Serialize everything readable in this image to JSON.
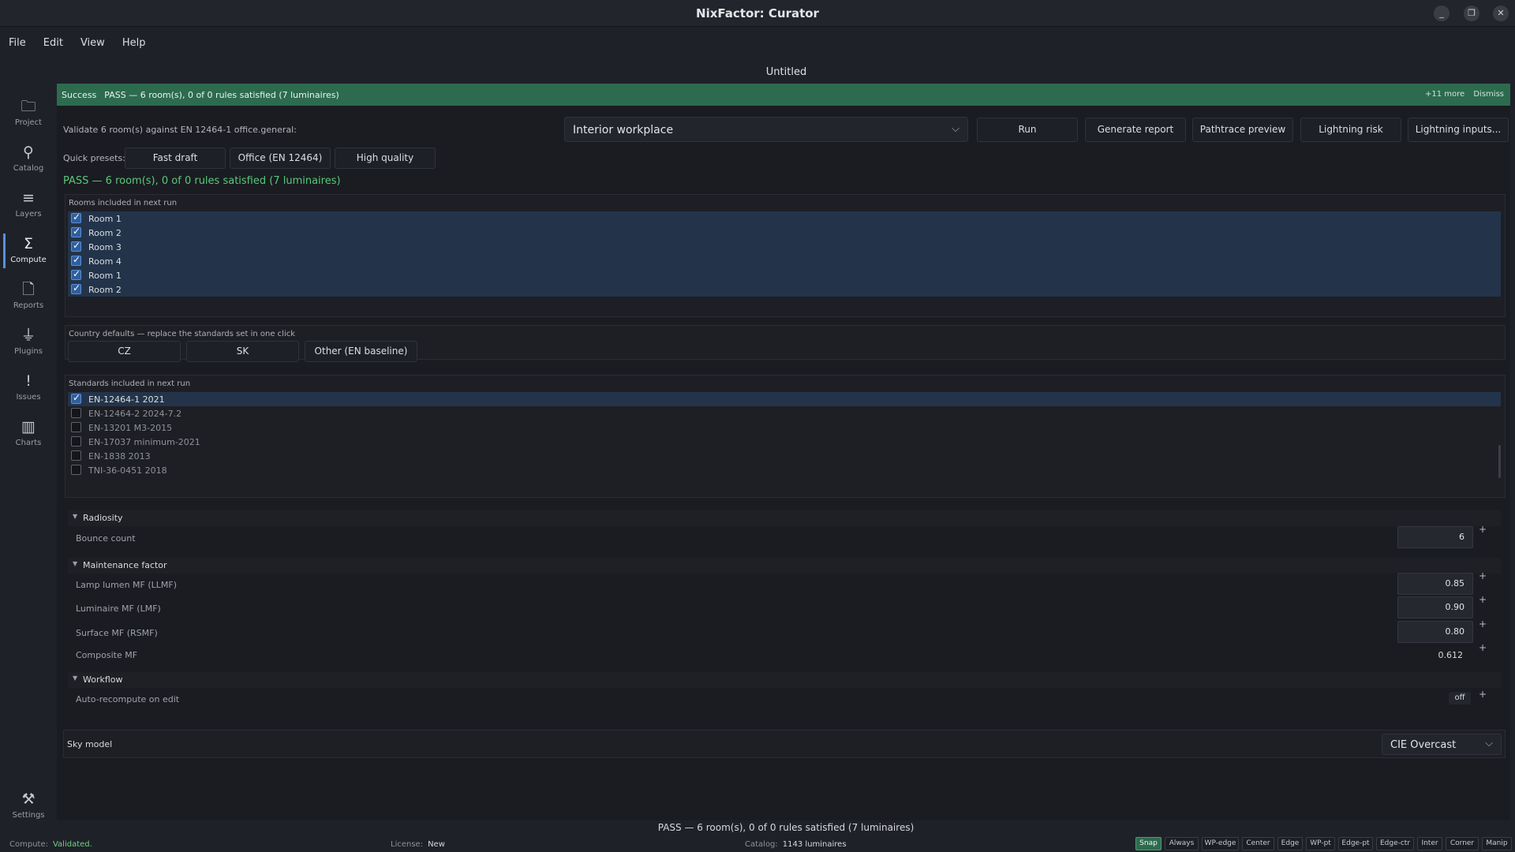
{
  "window": {
    "title": "NixFactor: Curator"
  },
  "menu": {
    "items": [
      "File",
      "Edit",
      "View",
      "Help"
    ]
  },
  "document": {
    "title": "Untitled"
  },
  "sidebar": {
    "items": [
      {
        "label": "Project",
        "icon": "folder-icon"
      },
      {
        "label": "Catalog",
        "icon": "bulb-icon"
      },
      {
        "label": "Layers",
        "icon": "layers-icon"
      },
      {
        "label": "Compute",
        "icon": "sigma-icon",
        "active": true
      },
      {
        "label": "Reports",
        "icon": "document-icon"
      },
      {
        "label": "Plugins",
        "icon": "plug-icon"
      },
      {
        "label": "Issues",
        "icon": "exclamation-icon"
      },
      {
        "label": "Charts",
        "icon": "bar-chart-icon"
      }
    ],
    "settings": {
      "label": "Settings",
      "icon": "tools-icon"
    }
  },
  "banner": {
    "label": "Success",
    "message": "PASS — 6 room(s), 0 of 0 rules satisfied (7 luminaires)",
    "more": "+11 more",
    "dismiss": "Dismiss",
    "color": "#2d6b4e"
  },
  "validate": {
    "label": "Validate 6 room(s) against EN 12464-1 office.general:",
    "profile": "Interior workplace",
    "buttons": {
      "run": "Run",
      "report": "Generate report",
      "pathtrace": "Pathtrace preview",
      "lightning": "Lightning risk",
      "lightning_inputs": "Lightning inputs..."
    }
  },
  "presets": {
    "label": "Quick presets:",
    "items": [
      "Fast draft",
      "Office (EN 12464)",
      "High quality"
    ]
  },
  "result": {
    "text": "PASS — 6 room(s), 0 of 0 rules satisfied (7 luminaires)",
    "color": "#5ac878"
  },
  "rooms": {
    "title": "Rooms included in next run",
    "items": [
      {
        "name": "Room 1",
        "checked": true
      },
      {
        "name": "Room 2",
        "checked": true
      },
      {
        "name": "Room 3",
        "checked": true
      },
      {
        "name": "Room 4",
        "checked": true
      },
      {
        "name": "Room 1",
        "checked": true
      },
      {
        "name": "Room 2",
        "checked": true
      }
    ]
  },
  "country": {
    "title": "Country defaults — replace the standards set in one click",
    "buttons": [
      "CZ",
      "SK",
      "Other (EN baseline)"
    ]
  },
  "standards": {
    "title": "Standards included in next run",
    "items": [
      {
        "name": "EN-12464-1 2021",
        "checked": true
      },
      {
        "name": "EN-12464-2 2024-7.2",
        "checked": false
      },
      {
        "name": "EN-13201 M3-2015",
        "checked": false
      },
      {
        "name": "EN-17037 minimum-2021",
        "checked": false
      },
      {
        "name": "EN-1838 2013",
        "checked": false
      },
      {
        "name": "TNI-36-0451 2018",
        "checked": false
      }
    ]
  },
  "radiosity": {
    "title": "Radiosity",
    "bounce_label": "Bounce count",
    "bounce_value": "6"
  },
  "maintenance": {
    "title": "Maintenance factor",
    "llmf_label": "Lamp lumen MF (LLMF)",
    "llmf": "0.85",
    "lmf_label": "Luminaire MF (LMF)",
    "lmf": "0.90",
    "rsmf_label": "Surface MF (RSMF)",
    "rsmf": "0.80",
    "composite_label": "Composite MF",
    "composite": "0.612"
  },
  "workflow": {
    "title": "Workflow",
    "auto_label": "Auto-recompute on edit",
    "auto_value": "off"
  },
  "sky": {
    "label": "Sky model",
    "value": "CIE Overcast"
  },
  "bottom_message": "PASS — 6 room(s), 0 of 0 rules satisfied (7 luminaires)",
  "status": {
    "compute_label": "Compute:",
    "compute_value": "Validated.",
    "license_label": "License:",
    "license_value": "New",
    "catalog_label": "Catalog:",
    "catalog_value": "1143 luminaires"
  },
  "snaps": [
    "Snap",
    "Always",
    "WP-edge",
    "Center",
    "Edge",
    "WP-pt",
    "Edge-pt",
    "Edge-ctr",
    "Inter",
    "Corner",
    "Manip"
  ]
}
